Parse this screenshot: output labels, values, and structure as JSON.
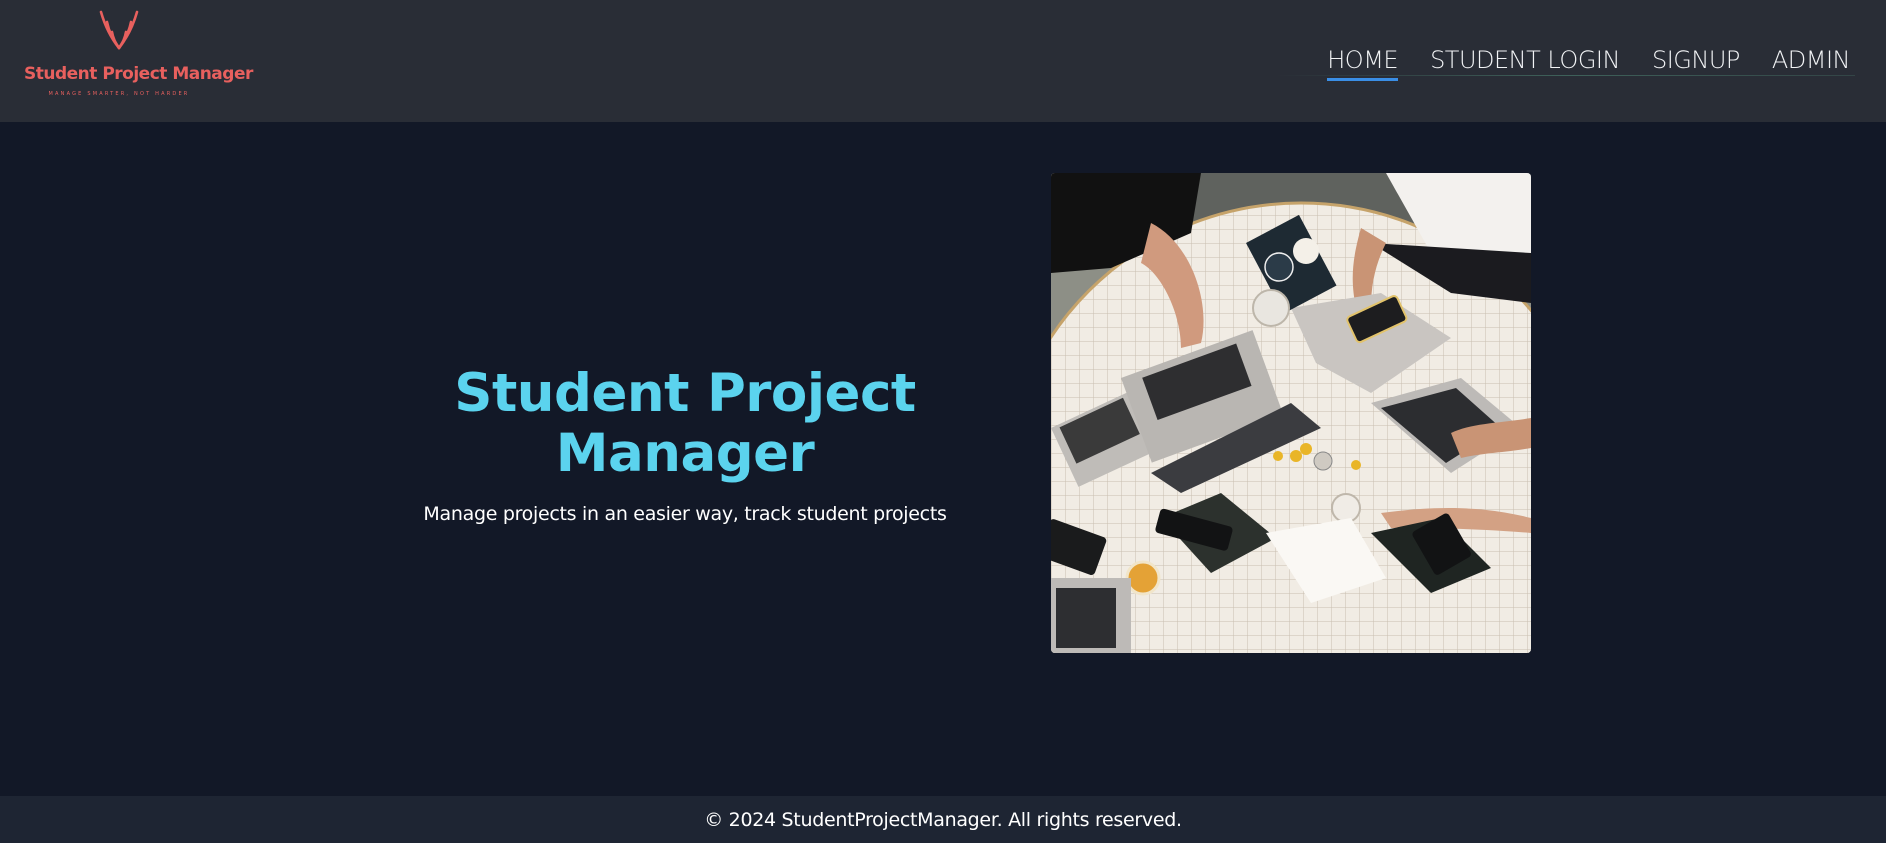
{
  "header": {
    "logo": {
      "title": "Student Project Manager",
      "tagline": "MANAGE SMARTER, NOT HARDER",
      "icon": "feather-wings-icon"
    },
    "nav": [
      {
        "label": "HOME",
        "active": true
      },
      {
        "label": "STUDENT LOGIN",
        "active": false
      },
      {
        "label": "SIGNUP",
        "active": false
      },
      {
        "label": "ADMIN",
        "active": false
      }
    ]
  },
  "hero": {
    "title": "Student Project Manager",
    "subtitle": "Manage projects in an easier way, track student projects",
    "image": "team-laptops-photo"
  },
  "footer": {
    "text": "© 2024 StudentProjectManager. All rights reserved."
  },
  "colors": {
    "header_bg": "#292d36",
    "page_bg": "#121827",
    "footer_bg": "#1e2533",
    "accent_title": "#5bd3ee",
    "logo_red": "#e8605e",
    "nav_underline": "#3a8ee6"
  }
}
